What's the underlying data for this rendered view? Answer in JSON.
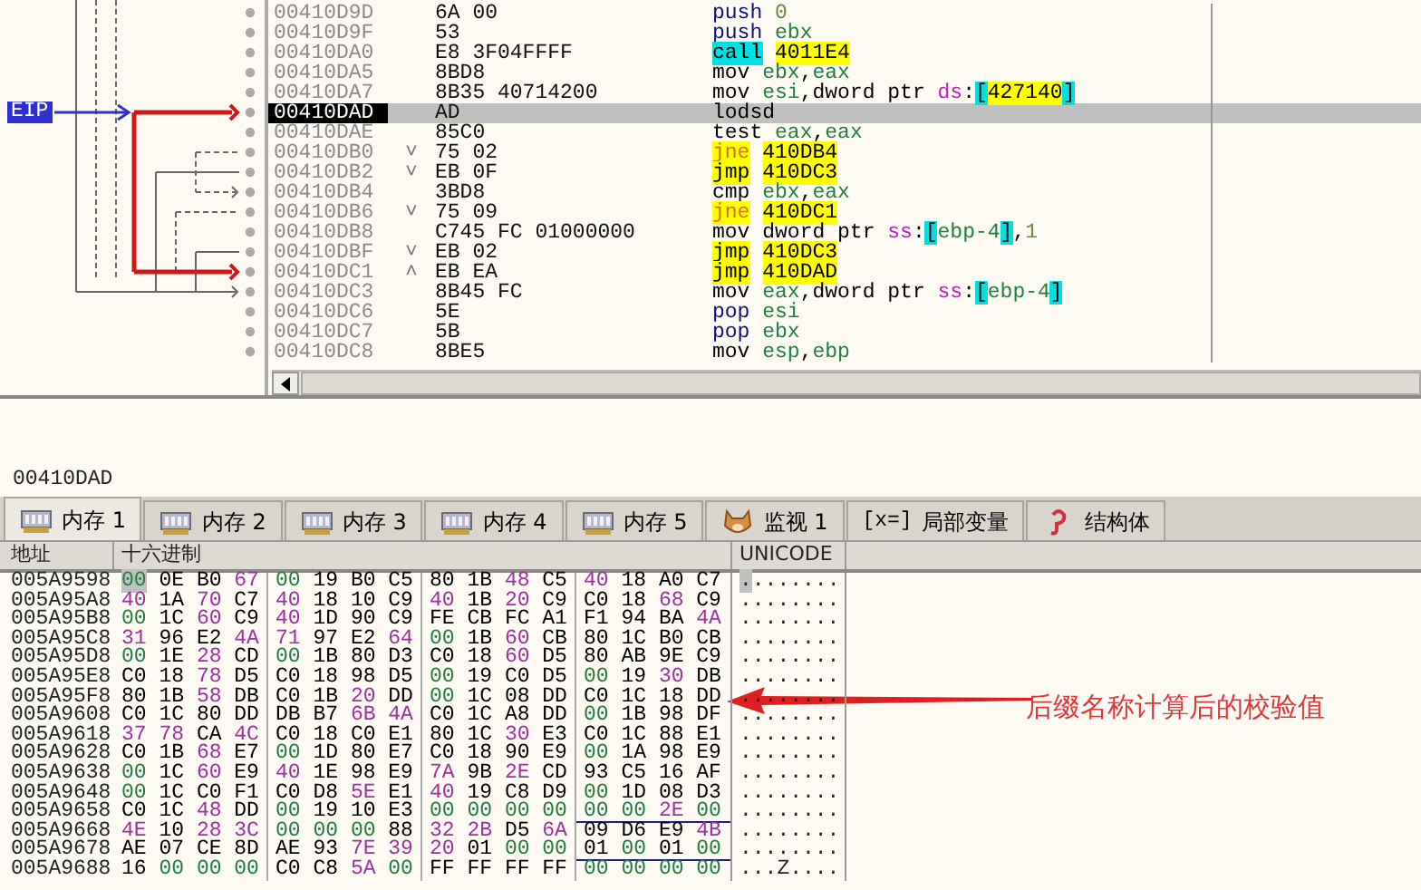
{
  "disassembly": {
    "eip_label": "EIP",
    "rows": [
      {
        "address": "00410D9D",
        "jump_mark": "",
        "bytes": "6A 00",
        "mnemonic": "push",
        "kind": "stack",
        "selected": false,
        "operands": [
          {
            "t": "0",
            "kind": "num"
          }
        ]
      },
      {
        "address": "00410D9F",
        "jump_mark": "",
        "bytes": "53",
        "mnemonic": "push",
        "kind": "stack",
        "selected": false,
        "operands": [
          {
            "t": "ebx",
            "kind": "reg"
          }
        ]
      },
      {
        "address": "00410DA0",
        "jump_mark": "",
        "bytes": "E8 3F04FFFF",
        "mnemonic": "call",
        "kind": "call",
        "selected": false,
        "operands": [
          {
            "t": "4011E4",
            "kind": "addr"
          }
        ]
      },
      {
        "address": "00410DA5",
        "jump_mark": "",
        "bytes": "8BD8",
        "mnemonic": "mov",
        "kind": "plain",
        "selected": false,
        "operands": [
          {
            "t": "ebx",
            "kind": "reg"
          },
          {
            "t": ",",
            "kind": "punct"
          },
          {
            "t": "eax",
            "kind": "reg"
          }
        ]
      },
      {
        "address": "00410DA7",
        "jump_mark": "",
        "bytes": "8B35 40714200",
        "mnemonic": "mov",
        "kind": "plain",
        "selected": false,
        "operands": [
          {
            "t": "esi",
            "kind": "reg"
          },
          {
            "t": ",dword ptr ",
            "kind": "punct"
          },
          {
            "t": "ds",
            "kind": "seg"
          },
          {
            "t": ":",
            "kind": "punct"
          },
          {
            "t": "[",
            "kind": "bracket"
          },
          {
            "t": "427140",
            "kind": "addr"
          },
          {
            "t": "]",
            "kind": "bracket"
          }
        ]
      },
      {
        "address": "00410DAD",
        "jump_mark": "",
        "bytes": "AD",
        "mnemonic": "lodsd",
        "kind": "plain",
        "selected": true,
        "operands": []
      },
      {
        "address": "00410DAE",
        "jump_mark": "",
        "bytes": "85C0",
        "mnemonic": "test",
        "kind": "plain",
        "selected": false,
        "operands": [
          {
            "t": "eax",
            "kind": "reg"
          },
          {
            "t": ",",
            "kind": "punct"
          },
          {
            "t": "eax",
            "kind": "reg"
          }
        ]
      },
      {
        "address": "00410DB0",
        "jump_mark": "˅",
        "bytes": "75 02",
        "mnemonic": "jne",
        "kind": "jcc",
        "selected": false,
        "operands": [
          {
            "t": "410DB4",
            "kind": "addr"
          }
        ]
      },
      {
        "address": "00410DB2",
        "jump_mark": "˅",
        "bytes": "EB 0F",
        "mnemonic": "jmp",
        "kind": "jmp",
        "selected": false,
        "operands": [
          {
            "t": "410DC3",
            "kind": "addr"
          }
        ]
      },
      {
        "address": "00410DB4",
        "jump_mark": "",
        "bytes": "3BD8",
        "mnemonic": "cmp",
        "kind": "plain",
        "selected": false,
        "operands": [
          {
            "t": "ebx",
            "kind": "reg"
          },
          {
            "t": ",",
            "kind": "punct"
          },
          {
            "t": "eax",
            "kind": "reg"
          }
        ]
      },
      {
        "address": "00410DB6",
        "jump_mark": "˅",
        "bytes": "75 09",
        "mnemonic": "jne",
        "kind": "jcc",
        "selected": false,
        "operands": [
          {
            "t": "410DC1",
            "kind": "addr"
          }
        ]
      },
      {
        "address": "00410DB8",
        "jump_mark": "",
        "bytes": "C745 FC 01000000",
        "mnemonic": "mov",
        "kind": "plain",
        "selected": false,
        "operands": [
          {
            "t": "dword ptr ",
            "kind": "punct"
          },
          {
            "t": "ss",
            "kind": "seg"
          },
          {
            "t": ":",
            "kind": "punct"
          },
          {
            "t": "[",
            "kind": "bracket"
          },
          {
            "t": "ebp-4",
            "kind": "reg"
          },
          {
            "t": "]",
            "kind": "bracket"
          },
          {
            "t": ",",
            "kind": "punct"
          },
          {
            "t": "1",
            "kind": "num"
          }
        ]
      },
      {
        "address": "00410DBF",
        "jump_mark": "˅",
        "bytes": "EB 02",
        "mnemonic": "jmp",
        "kind": "jmp",
        "selected": false,
        "operands": [
          {
            "t": "410DC3",
            "kind": "addr"
          }
        ]
      },
      {
        "address": "00410DC1",
        "jump_mark": "˄",
        "bytes": "EB EA",
        "mnemonic": "jmp",
        "kind": "jmp",
        "selected": false,
        "operands": [
          {
            "t": "410DAD",
            "kind": "addr"
          }
        ]
      },
      {
        "address": "00410DC3",
        "jump_mark": "",
        "bytes": "8B45 FC",
        "mnemonic": "mov",
        "kind": "plain",
        "selected": false,
        "operands": [
          {
            "t": "eax",
            "kind": "reg"
          },
          {
            "t": ",dword ptr ",
            "kind": "punct"
          },
          {
            "t": "ss",
            "kind": "seg"
          },
          {
            "t": ":",
            "kind": "punct"
          },
          {
            "t": "[",
            "kind": "bracket"
          },
          {
            "t": "ebp-4",
            "kind": "reg"
          },
          {
            "t": "]",
            "kind": "bracket"
          }
        ]
      },
      {
        "address": "00410DC6",
        "jump_mark": "",
        "bytes": "5E",
        "mnemonic": "pop",
        "kind": "stack",
        "selected": false,
        "operands": [
          {
            "t": "esi",
            "kind": "reg"
          }
        ]
      },
      {
        "address": "00410DC7",
        "jump_mark": "",
        "bytes": "5B",
        "mnemonic": "pop",
        "kind": "stack",
        "selected": false,
        "operands": [
          {
            "t": "ebx",
            "kind": "reg"
          }
        ]
      },
      {
        "address": "00410DC8",
        "jump_mark": "",
        "bytes": "8BE5",
        "mnemonic": "mov",
        "kind": "plain",
        "selected": false,
        "operands": [
          {
            "t": "esp",
            "kind": "reg"
          },
          {
            "t": ",",
            "kind": "punct"
          },
          {
            "t": "ebp",
            "kind": "reg"
          }
        ]
      }
    ]
  },
  "info": {
    "text": "00410DAD"
  },
  "tabs": [
    {
      "label": "内存 1",
      "kind": "memory",
      "selected": true
    },
    {
      "label": "内存 2",
      "kind": "memory",
      "selected": false
    },
    {
      "label": "内存 3",
      "kind": "memory",
      "selected": false
    },
    {
      "label": "内存 4",
      "kind": "memory",
      "selected": false
    },
    {
      "label": "内存 5",
      "kind": "memory",
      "selected": false
    },
    {
      "label": "监视 1",
      "kind": "watch",
      "selected": false
    },
    {
      "label": "局部变量",
      "kind": "locals",
      "icon_text": "[x=]",
      "selected": false
    },
    {
      "label": "结构体",
      "kind": "struct",
      "selected": false
    }
  ],
  "dump": {
    "columns": [
      "地址",
      "十六进制",
      "UNICODE"
    ],
    "rows": [
      {
        "address": "005A9598",
        "bytes": "00 0E B0 67 00 19 B0 C5 80 1B 48 C5 40 18 A0 C7",
        "unicode": "........",
        "selected": true,
        "underlined": false
      },
      {
        "address": "005A95A8",
        "bytes": "40 1A 70 C7 40 18 10 C9 40 1B 20 C9 C0 18 68 C9",
        "unicode": "........",
        "selected": false,
        "underlined": false
      },
      {
        "address": "005A95B8",
        "bytes": "00 1C 60 C9 40 1D 90 C9 FE CB FC A1 F1 94 BA 4A",
        "unicode": "........",
        "selected": false,
        "underlined": false
      },
      {
        "address": "005A95C8",
        "bytes": "31 96 E2 4A 71 97 E2 64 00 1B 60 CB 80 1C B0 CB",
        "unicode": "........",
        "selected": false,
        "underlined": false
      },
      {
        "address": "005A95D8",
        "bytes": "00 1E 28 CD 00 1B 80 D3 C0 18 60 D5 80 AB 9E C9",
        "unicode": "........",
        "selected": false,
        "underlined": false
      },
      {
        "address": "005A95E8",
        "bytes": "C0 18 78 D5 C0 18 98 D5 00 19 C0 D5 00 19 30 DB",
        "unicode": "........",
        "selected": false,
        "underlined": false
      },
      {
        "address": "005A95F8",
        "bytes": "80 1B 58 DB C0 1B 20 DD 00 1C 08 DD C0 1C 18 DD",
        "unicode": "........",
        "selected": false,
        "underlined": false
      },
      {
        "address": "005A9608",
        "bytes": "C0 1C 80 DD DB B7 6B 4A C0 1C A8 DD 00 1B 98 DF",
        "unicode": "........",
        "selected": false,
        "underlined": false
      },
      {
        "address": "005A9618",
        "bytes": "37 78 CA 4C C0 18 C0 E1 80 1C 30 E3 C0 1C 88 E1",
        "unicode": "........",
        "selected": false,
        "underlined": false
      },
      {
        "address": "005A9628",
        "bytes": "C0 1B 68 E7 00 1D 80 E7 C0 18 90 E9 00 1A 98 E9",
        "unicode": "........",
        "selected": false,
        "underlined": false
      },
      {
        "address": "005A9638",
        "bytes": "00 1C 60 E9 40 1E 98 E9 7A 9B 2E CD 93 C5 16 AF",
        "unicode": "........",
        "selected": false,
        "underlined": false
      },
      {
        "address": "005A9648",
        "bytes": "00 1C C0 F1 C0 D8 5E E1 40 19 C8 D9 00 1D 08 D3",
        "unicode": "........",
        "selected": false,
        "underlined": false
      },
      {
        "address": "005A9658",
        "bytes": "C0 1C 48 DD 00 19 10 E3 00 00 00 00 00 00 2E 00",
        "unicode": "........",
        "selected": false,
        "underlined": true
      },
      {
        "address": "005A9668",
        "bytes": "4E 10 28 3C 00 00 00 88 32 2B D5 6A 09 D6 E9 4B",
        "unicode": "........",
        "selected": false,
        "underlined": false
      },
      {
        "address": "005A9678",
        "bytes": "AE 07 CE 8D AE 93 7E 39 20 01 00 00 01 00 01 00",
        "unicode": "........",
        "selected": false,
        "underlined": true
      },
      {
        "address": "005A9688",
        "bytes": "16 00 00 00 C0 C8 5A 00 FF FF FF FF 00 00 00 00",
        "unicode": "...Z....",
        "selected": false,
        "underlined": false
      }
    ]
  },
  "annotation": {
    "text": "后缀名称计算后的校验值"
  }
}
